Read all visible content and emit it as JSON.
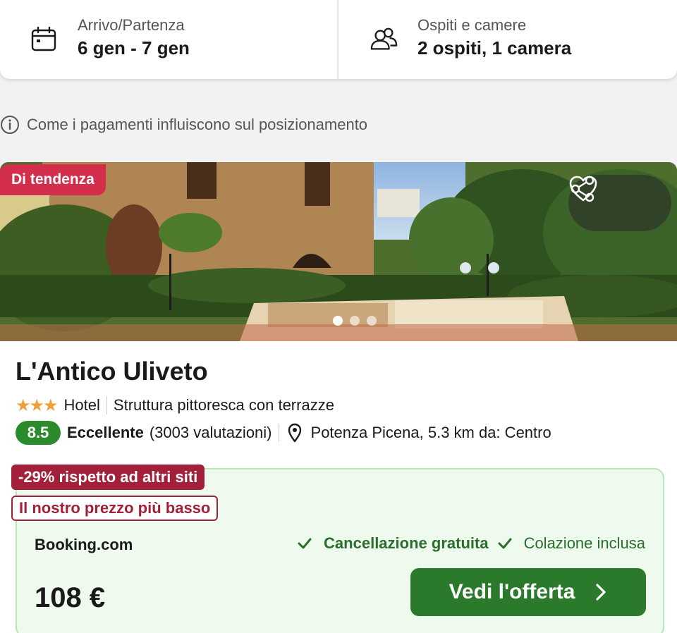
{
  "search": {
    "dates_label": "Arrivo/Partenza",
    "dates_value": "6 gen - 7 gen",
    "guests_label": "Ospiti e camere",
    "guests_value": "2 ospiti, 1 camera"
  },
  "info": {
    "text": "Come i pagamenti influiscono sul posizionamento"
  },
  "hotel": {
    "badge": "Di tendenza",
    "name": "L'Antico Uliveto",
    "stars": "★★★",
    "star_count": 3,
    "type": "Hotel",
    "description": "Struttura pittoresca con terrazze",
    "score": "8.5",
    "rating_word": "Eccellente",
    "rating_count": "(3003 valutazioni)",
    "location": "Potenza Picena, 5.3 km da: Centro",
    "photo_count": 3,
    "active_photo": 1
  },
  "deal": {
    "discount_tag": "-29% rispetto ad altri siti",
    "lowest_tag": "Il nostro prezzo più basso",
    "provider": "Booking.com",
    "perk_cancellation": "Cancellazione gratuita",
    "perk_breakfast": "Colazione inclusa",
    "price": "108 €",
    "cta_label": "Vedi l'offerta"
  },
  "colors": {
    "trend_badge": "#d32f4c",
    "score_bg": "#2b8a2b",
    "discount_tag": "#a3203a",
    "cta_bg": "#2b7a2b",
    "deal_bg": "#effaef",
    "stars": "#f0a039"
  },
  "icons": [
    "calendar-icon",
    "guests-icon",
    "info-icon",
    "share-icon",
    "heart-icon",
    "location-pin-icon",
    "check-icon",
    "chevron-right-icon"
  ]
}
